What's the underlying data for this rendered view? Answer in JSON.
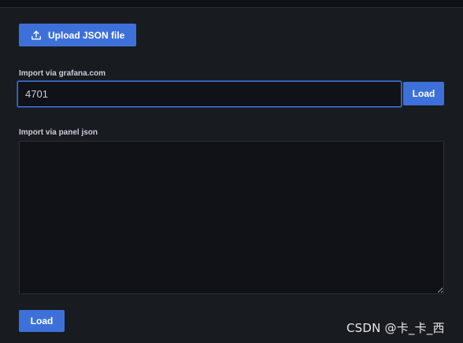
{
  "upload": {
    "label": "Upload JSON file",
    "icon": "upload-icon"
  },
  "grafana_import": {
    "label": "Import via grafana.com",
    "value": "4701",
    "load_label": "Load"
  },
  "panel_import": {
    "label": "Import via panel json",
    "value": ""
  },
  "footer": {
    "load_label": "Load"
  },
  "watermark": "CSDN @卡_卡_西",
  "colors": {
    "background": "#181b1f",
    "input_background": "#111217",
    "accent": "#3d71d9",
    "text": "#ccccdc"
  }
}
